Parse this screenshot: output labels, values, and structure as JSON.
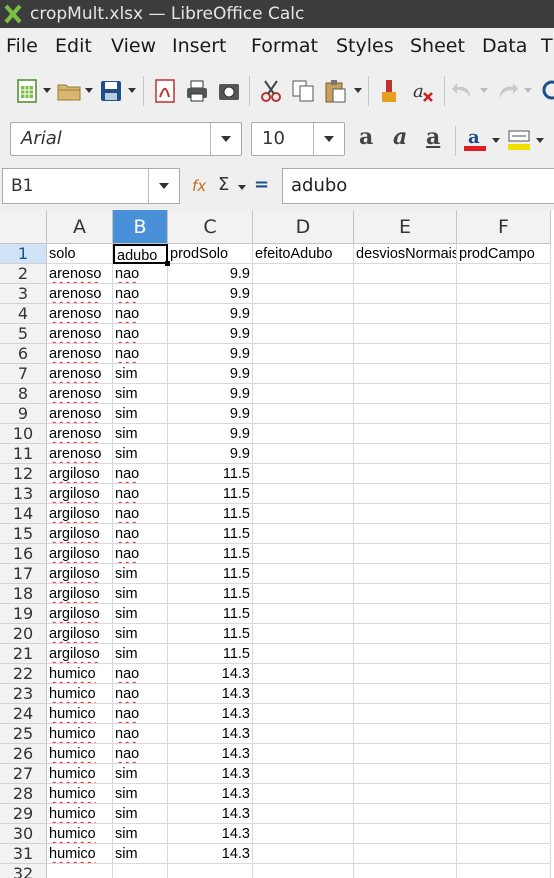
{
  "window": {
    "title": "cropMult.xlsx — LibreOffice Calc"
  },
  "menu": [
    "File",
    "Edit",
    "View",
    "Insert",
    "Format",
    "Styles",
    "Sheet",
    "Data",
    "T"
  ],
  "toolbar": {
    "icons": [
      "new-document-icon",
      "open-folder-icon",
      "save-icon",
      "export-pdf-icon",
      "print-icon",
      "print-preview-icon",
      "cut-icon",
      "copy-icon",
      "paste-icon",
      "clone-formatting-icon",
      "clear-formatting-icon",
      "undo-icon",
      "redo-icon",
      "find-icon"
    ]
  },
  "format": {
    "font_name": "Arial",
    "font_size": "10",
    "font_color": "#e02020",
    "highlight_color": "#f0e000"
  },
  "formula_bar": {
    "name_box": "B1",
    "fx": "fx",
    "sigma": "Σ",
    "equals": "=",
    "content": "adubo"
  },
  "sheet": {
    "columns": [
      "A",
      "B",
      "C",
      "D",
      "E",
      "F"
    ],
    "selected_column": "B",
    "active_cell": "B1",
    "header_row": [
      "solo",
      "adubo",
      "prodSolo",
      "efeitoAdubo",
      "desviosNormais",
      "prodCampo"
    ],
    "rows": [
      [
        "arenoso",
        "nao",
        "9.9"
      ],
      [
        "arenoso",
        "nao",
        "9.9"
      ],
      [
        "arenoso",
        "nao",
        "9.9"
      ],
      [
        "arenoso",
        "nao",
        "9.9"
      ],
      [
        "arenoso",
        "nao",
        "9.9"
      ],
      [
        "arenoso",
        "sim",
        "9.9"
      ],
      [
        "arenoso",
        "sim",
        "9.9"
      ],
      [
        "arenoso",
        "sim",
        "9.9"
      ],
      [
        "arenoso",
        "sim",
        "9.9"
      ],
      [
        "arenoso",
        "sim",
        "9.9"
      ],
      [
        "argiloso",
        "nao",
        "11.5"
      ],
      [
        "argiloso",
        "nao",
        "11.5"
      ],
      [
        "argiloso",
        "nao",
        "11.5"
      ],
      [
        "argiloso",
        "nao",
        "11.5"
      ],
      [
        "argiloso",
        "nao",
        "11.5"
      ],
      [
        "argiloso",
        "sim",
        "11.5"
      ],
      [
        "argiloso",
        "sim",
        "11.5"
      ],
      [
        "argiloso",
        "sim",
        "11.5"
      ],
      [
        "argiloso",
        "sim",
        "11.5"
      ],
      [
        "argiloso",
        "sim",
        "11.5"
      ],
      [
        "humico",
        "nao",
        "14.3"
      ],
      [
        "humico",
        "nao",
        "14.3"
      ],
      [
        "humico",
        "nao",
        "14.3"
      ],
      [
        "humico",
        "nao",
        "14.3"
      ],
      [
        "humico",
        "nao",
        "14.3"
      ],
      [
        "humico",
        "sim",
        "14.3"
      ],
      [
        "humico",
        "sim",
        "14.3"
      ],
      [
        "humico",
        "sim",
        "14.3"
      ],
      [
        "humico",
        "sim",
        "14.3"
      ],
      [
        "humico",
        "sim",
        "14.3"
      ]
    ],
    "row_numbers": [
      "1",
      "2",
      "3",
      "4",
      "5",
      "6",
      "7",
      "8",
      "9",
      "10",
      "11",
      "12",
      "13",
      "14",
      "15",
      "16",
      "17",
      "18",
      "19",
      "20",
      "21",
      "22",
      "23",
      "24",
      "25",
      "26",
      "27",
      "28",
      "29",
      "30",
      "31",
      "32"
    ]
  }
}
